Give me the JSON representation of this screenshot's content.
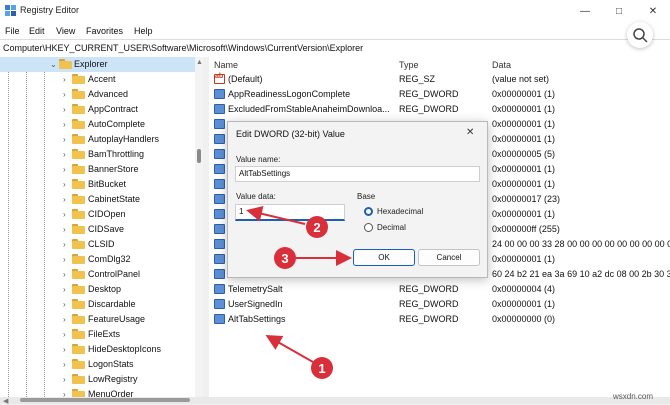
{
  "app": {
    "title": "Registry Editor"
  },
  "menu": [
    "File",
    "Edit",
    "View",
    "Favorites",
    "Help"
  ],
  "address": "Computer\\HKEY_CURRENT_USER\\Software\\Microsoft\\Windows\\CurrentVersion\\Explorer",
  "tree": {
    "parent": "Explorer",
    "children": [
      "Accent",
      "Advanced",
      "AppContract",
      "AutoComplete",
      "AutoplayHandlers",
      "BamThrottling",
      "BannerStore",
      "BitBucket",
      "CabinetState",
      "CIDOpen",
      "CIDSave",
      "CLSID",
      "ComDlg32",
      "ControlPanel",
      "Desktop",
      "Discardable",
      "FeatureUsage",
      "FileExts",
      "HideDesktopIcons",
      "LogonStats",
      "LowRegistry",
      "MenuOrder"
    ]
  },
  "columns": {
    "name": "Name",
    "type": "Type",
    "data": "Data"
  },
  "values": [
    {
      "name": "(Default)",
      "type": "REG_SZ",
      "data": "(value not set)",
      "kind": "string"
    },
    {
      "name": "AppReadinessLogonComplete",
      "type": "REG_DWORD",
      "data": "0x00000001 (1)",
      "kind": "dword"
    },
    {
      "name": "ExcludedFromStableAnaheimDownloa...",
      "type": "REG_DWORD",
      "data": "0x00000001 (1)",
      "kind": "dword"
    },
    {
      "name": "",
      "type": "",
      "data": "0x00000001 (1)",
      "kind": "dword"
    },
    {
      "name": "",
      "type": "",
      "data": "0x00000001 (1)",
      "kind": "dword"
    },
    {
      "name": "",
      "type": "",
      "data": "0x00000005 (5)",
      "kind": "dword"
    },
    {
      "name": "",
      "type": "",
      "data": "0x00000001 (1)",
      "kind": "dword"
    },
    {
      "name": "",
      "type": "",
      "data": "0x00000001 (1)",
      "kind": "dword"
    },
    {
      "name": "",
      "type": "",
      "data": "0x00000017 (23)",
      "kind": "dword"
    },
    {
      "name": "",
      "type": "",
      "data": "0x00000001 (1)",
      "kind": "dword"
    },
    {
      "name": "",
      "type": "",
      "data": "0x000000ff (255)",
      "kind": "dword"
    },
    {
      "name": "",
      "type": "",
      "data": "24 00 00 00 33 28 00 00 00 00 00 00 00 00 00",
      "kind": "dword"
    },
    {
      "name": "",
      "type": "",
      "data": "0x00000001 (1)",
      "kind": "dword"
    },
    {
      "name": "",
      "type": "",
      "data": "60 24 b2 21 ea 3a 69 10 a2 dc 08 00 2b 30 30 9d",
      "kind": "dword"
    },
    {
      "name": "TelemetrySalt",
      "type": "REG_DWORD",
      "data": "0x00000004 (4)",
      "kind": "dword"
    },
    {
      "name": "UserSignedIn",
      "type": "REG_DWORD",
      "data": "0x00000001 (1)",
      "kind": "dword"
    },
    {
      "name": "AltTabSettings",
      "type": "REG_DWORD",
      "data": "0x00000000 (0)",
      "kind": "dword"
    }
  ],
  "dialog": {
    "title": "Edit DWORD (32-bit) Value",
    "value_name_label": "Value name:",
    "value_name": "AltTabSettings",
    "value_data_label": "Value data:",
    "value_data": "1",
    "base_label": "Base",
    "base_options": [
      "Hexadecimal",
      "Decimal"
    ],
    "base_selected": "Hexadecimal",
    "ok": "OK",
    "cancel": "Cancel"
  },
  "annotations": [
    "1",
    "2",
    "3"
  ],
  "watermark": "wsxdn.com",
  "colors": {
    "annotation": "#d92f3b",
    "selection": "#cce4f7",
    "accent": "#1a5fb4",
    "folder": "#f1c24e"
  }
}
